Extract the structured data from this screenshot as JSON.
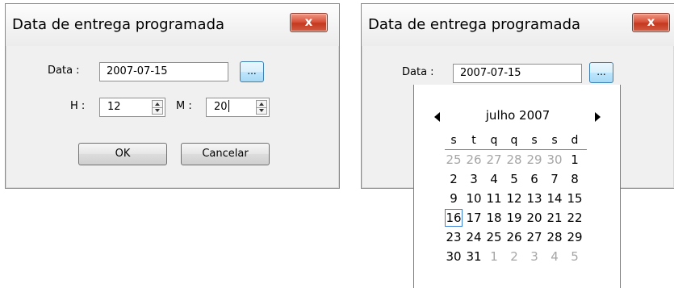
{
  "left_dialog": {
    "title": "Data de entrega programada",
    "close_label": "x",
    "date_label": "Data :",
    "date_value": "2007-07-15",
    "browse_label": "...",
    "hour_label": "H :",
    "hour_value": "12",
    "minute_label": "M :",
    "minute_value": "20",
    "ok_label": "OK",
    "cancel_label": "Cancelar"
  },
  "right_dialog": {
    "title": "Data de entrega programada",
    "close_label": "x",
    "date_label": "Data :",
    "date_value": "2007-07-15",
    "browse_label": "..."
  },
  "calendar": {
    "month_title": "julho 2007",
    "weekdays": [
      "s",
      "t",
      "q",
      "q",
      "s",
      "s",
      "d"
    ],
    "weeks": [
      [
        {
          "d": "25",
          "other": true
        },
        {
          "d": "26",
          "other": true
        },
        {
          "d": "27",
          "other": true
        },
        {
          "d": "28",
          "other": true
        },
        {
          "d": "29",
          "other": true
        },
        {
          "d": "30",
          "other": true
        },
        {
          "d": "1",
          "other": false
        }
      ],
      [
        {
          "d": "2",
          "other": false
        },
        {
          "d": "3",
          "other": false
        },
        {
          "d": "4",
          "other": false
        },
        {
          "d": "5",
          "other": false
        },
        {
          "d": "6",
          "other": false
        },
        {
          "d": "7",
          "other": false
        },
        {
          "d": "8",
          "other": false
        }
      ],
      [
        {
          "d": "9",
          "other": false
        },
        {
          "d": "10",
          "other": false
        },
        {
          "d": "11",
          "other": false
        },
        {
          "d": "12",
          "other": false
        },
        {
          "d": "13",
          "other": false
        },
        {
          "d": "14",
          "other": false
        },
        {
          "d": "15",
          "other": false
        }
      ],
      [
        {
          "d": "16",
          "other": false,
          "selected": true
        },
        {
          "d": "17",
          "other": false
        },
        {
          "d": "18",
          "other": false
        },
        {
          "d": "19",
          "other": false
        },
        {
          "d": "20",
          "other": false
        },
        {
          "d": "21",
          "other": false
        },
        {
          "d": "22",
          "other": false
        }
      ],
      [
        {
          "d": "23",
          "other": false
        },
        {
          "d": "24",
          "other": false
        },
        {
          "d": "25",
          "other": false
        },
        {
          "d": "26",
          "other": false
        },
        {
          "d": "27",
          "other": false
        },
        {
          "d": "28",
          "other": false
        },
        {
          "d": "29",
          "other": false
        }
      ],
      [
        {
          "d": "30",
          "other": false
        },
        {
          "d": "31",
          "other": false
        },
        {
          "d": "1",
          "other": true
        },
        {
          "d": "2",
          "other": true
        },
        {
          "d": "3",
          "other": true
        },
        {
          "d": "4",
          "other": true
        },
        {
          "d": "5",
          "other": true
        }
      ]
    ]
  }
}
